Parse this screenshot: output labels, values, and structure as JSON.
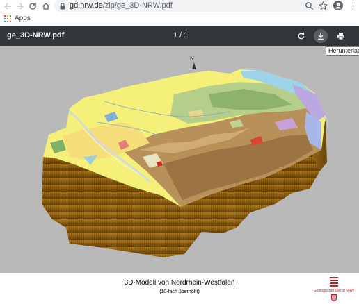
{
  "browser": {
    "url_host": "gd.nrw.de",
    "url_path": "/zip/ge_3D-NRW.pdf",
    "bookmarks": [
      {
        "label": "Apps"
      }
    ]
  },
  "pdf_viewer": {
    "title": "ge_3D-NRW.pdf",
    "page_indicator": "1 / 1",
    "tooltip": "Herunterladen",
    "compass_label": "N"
  },
  "document": {
    "caption_title": "3D-Modell von Nordrhein-Westfalen",
    "caption_subtitle": "(10-fach überhöht)",
    "logo_text": "Geologischer Dienst NRW"
  },
  "colors": {
    "toolbar_bg": "#323639",
    "viewer_bg": "#b9b9b9",
    "block_side": "#8a5d12",
    "logo_red": "#c0202a"
  }
}
